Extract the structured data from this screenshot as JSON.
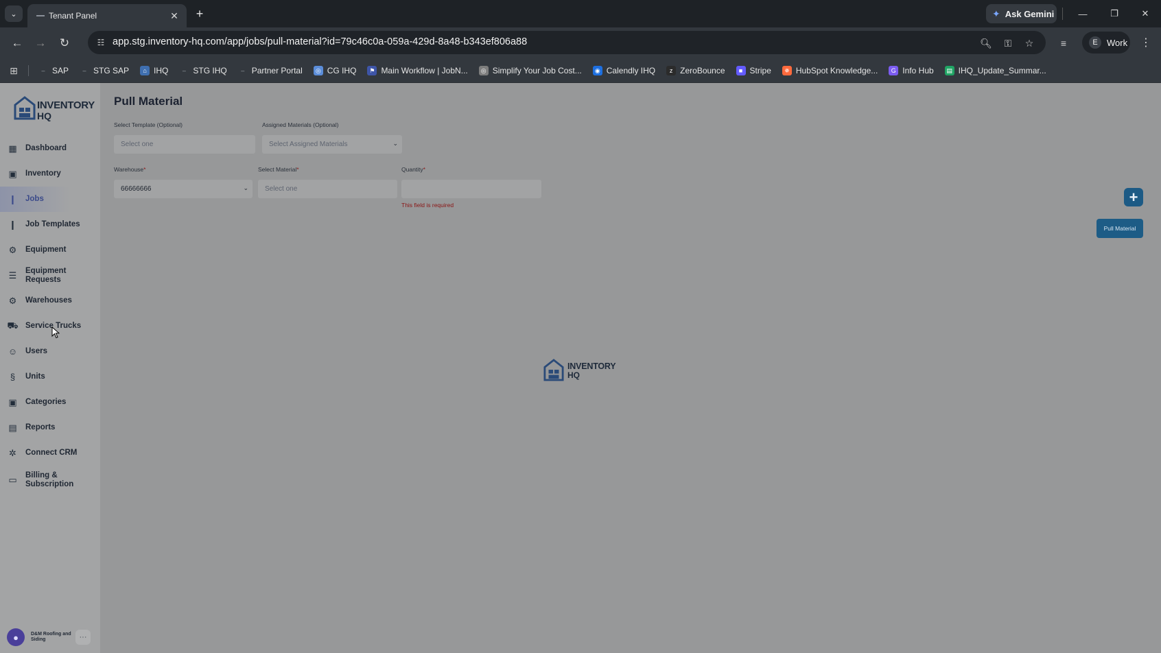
{
  "browser": {
    "tab_title": "Tenant Panel",
    "ask_gemini": "Ask Gemini",
    "url": "app.stg.inventory-hq.com/app/jobs/pull-material?id=79c46c0a-059a-429d-8a48-b343ef806a88",
    "profile_initial": "E",
    "profile_name": "Work",
    "bookmarks": [
      {
        "label": "SAP",
        "icon": "dash-icon",
        "color": "#9aa0a6"
      },
      {
        "label": "STG SAP",
        "icon": "dash-icon",
        "color": "#9aa0a6"
      },
      {
        "label": "IHQ",
        "icon": "house-icon",
        "color": "#3f6fb0"
      },
      {
        "label": "STG IHQ",
        "icon": "dash-icon",
        "color": "#9aa0a6"
      },
      {
        "label": "Partner Portal",
        "icon": "dash-icon",
        "color": "#9aa0a6"
      },
      {
        "label": "CG IHQ",
        "icon": "globe-icon",
        "color": "#5b8dd9"
      },
      {
        "label": "Main Workflow | JobN...",
        "icon": "flag-icon",
        "color": "#3e55a8"
      },
      {
        "label": "Simplify Your Job Cost...",
        "icon": "globe-icon",
        "color": "#7d7d7d"
      },
      {
        "label": "Calendly IHQ",
        "icon": "calendly-icon",
        "color": "#1d6fe0"
      },
      {
        "label": "ZeroBounce",
        "icon": "zb-icon",
        "color": "#2b2b2b"
      },
      {
        "label": "Stripe",
        "icon": "stripe-icon",
        "color": "#635bff"
      },
      {
        "label": "HubSpot Knowledge...",
        "icon": "hubspot-icon",
        "color": "#ff6a3d"
      },
      {
        "label": "Info Hub",
        "icon": "g-icon",
        "color": "#7b5cf0"
      },
      {
        "label": "IHQ_Update_Summar...",
        "icon": "sheet-icon",
        "color": "#20a464"
      }
    ]
  },
  "app": {
    "brand_line1": "INVENTORY",
    "brand_line2": "HQ",
    "nav": [
      {
        "label": "Dashboard",
        "icon": "grid-icon",
        "active": false
      },
      {
        "label": "Inventory",
        "icon": "boxes-icon",
        "active": false
      },
      {
        "label": "Jobs",
        "icon": "bar-chart-icon",
        "active": true
      },
      {
        "label": "Job Templates",
        "icon": "bar-chart-icon",
        "active": false
      },
      {
        "label": "Equipment",
        "icon": "tools-icon",
        "active": false
      },
      {
        "label": "Equipment Requests",
        "icon": "list-icon",
        "active": false
      },
      {
        "label": "Warehouses",
        "icon": "tools-icon",
        "active": false
      },
      {
        "label": "Service Trucks",
        "icon": "truck-icon",
        "active": false
      },
      {
        "label": "Users",
        "icon": "users-icon",
        "active": false
      },
      {
        "label": "Units",
        "icon": "units-icon",
        "active": false
      },
      {
        "label": "Categories",
        "icon": "boxes-icon",
        "active": false
      },
      {
        "label": "Reports",
        "icon": "report-icon",
        "active": false
      },
      {
        "label": "Connect CRM",
        "icon": "network-icon",
        "active": false
      },
      {
        "label": "Billing & Subscription",
        "icon": "card-icon",
        "active": false
      }
    ],
    "account_name": "D&M Roofing and Siding",
    "account_more": "···"
  },
  "form": {
    "title": "Pull Material",
    "template_label": "Select Template (Optional)",
    "template_placeholder": "Select one",
    "assigned_label": "Assigned Materials (Optional)",
    "assigned_placeholder": "Select Assigned Materials",
    "warehouse_label": "Warehouse",
    "warehouse_value": "66666666",
    "material_label": "Select Material",
    "material_placeholder": "Select one",
    "quantity_label": "Quantity",
    "quantity_value": "",
    "required_mark": "*",
    "error_text": "This field is required",
    "add_icon": "+",
    "pull_button": "Pull Material"
  },
  "loader": {
    "line1": "INVENTORY",
    "line2": "HQ"
  }
}
